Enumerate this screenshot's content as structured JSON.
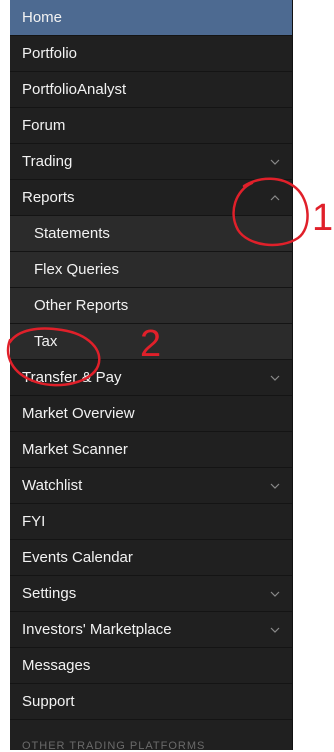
{
  "nav": {
    "items": [
      {
        "label": "Home"
      },
      {
        "label": "Portfolio"
      },
      {
        "label": "PortfolioAnalyst"
      },
      {
        "label": "Forum"
      },
      {
        "label": "Trading"
      },
      {
        "label": "Reports"
      },
      {
        "label": "Statements"
      },
      {
        "label": "Flex Queries"
      },
      {
        "label": "Other Reports"
      },
      {
        "label": "Tax"
      },
      {
        "label": "Transfer & Pay"
      },
      {
        "label": "Market Overview"
      },
      {
        "label": "Market Scanner"
      },
      {
        "label": "Watchlist"
      },
      {
        "label": "FYI"
      },
      {
        "label": "Events Calendar"
      },
      {
        "label": "Settings"
      },
      {
        "label": "Investors' Marketplace"
      },
      {
        "label": "Messages"
      },
      {
        "label": "Support"
      }
    ],
    "footer_label": "OTHER TRADING PLATFORMS"
  },
  "annotations": {
    "mark_1": "1",
    "mark_2": "2",
    "color": "#e0202a"
  },
  "colors": {
    "sidebar_bg": "#202020",
    "submenu_bg": "#2b2b2b",
    "active_bg": "#4d6a91",
    "text": "#f2f2f2"
  }
}
